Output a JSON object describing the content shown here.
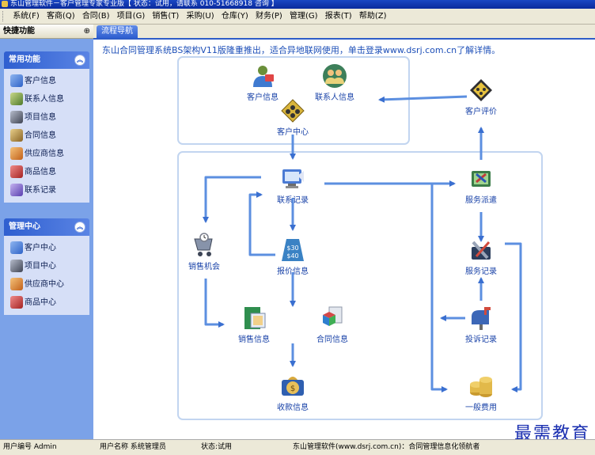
{
  "window": {
    "title": "东山管理软件－客户管理专家专业版【 状态：试用，请联系 010-51668918 咨询 】"
  },
  "menu": [
    {
      "label": "系统(F)"
    },
    {
      "label": "客商(Q)"
    },
    {
      "label": "合同(B)"
    },
    {
      "label": "项目(G)"
    },
    {
      "label": "销售(T)"
    },
    {
      "label": "采购(U)"
    },
    {
      "label": "仓库(Y)"
    },
    {
      "label": "财务(P)"
    },
    {
      "label": "管理(G)"
    },
    {
      "label": "报表(T)"
    },
    {
      "label": "帮助(Z)"
    }
  ],
  "sidebar": {
    "title": "快捷功能",
    "pin_glyph": "⊕",
    "panels": [
      {
        "title": "常用功能",
        "collapse_glyph": "︽",
        "items": [
          {
            "label": "客户信息",
            "icon": "customer-info-icon",
            "color": "#4a7fd6"
          },
          {
            "label": "联系人信息",
            "icon": "contact-info-icon",
            "color": "#6b8e3f"
          },
          {
            "label": "项目信息",
            "icon": "project-info-icon",
            "color": "#555b6a"
          },
          {
            "label": "合同信息",
            "icon": "contract-info-icon",
            "color": "#9c7a3a"
          },
          {
            "label": "供应商信息",
            "icon": "supplier-info-icon",
            "color": "#d9812b"
          },
          {
            "label": "商品信息",
            "icon": "product-info-icon",
            "color": "#c23a3a"
          },
          {
            "label": "联系记录",
            "icon": "contact-record-icon",
            "color": "#7a5fc8"
          }
        ]
      },
      {
        "title": "管理中心",
        "collapse_glyph": "︽",
        "items": [
          {
            "label": "客户中心",
            "icon": "customer-center-icon",
            "color": "#4a7fd6"
          },
          {
            "label": "项目中心",
            "icon": "project-center-icon",
            "color": "#555b6a"
          },
          {
            "label": "供应商中心",
            "icon": "supplier-center-icon",
            "color": "#d9812b"
          },
          {
            "label": "商品中心",
            "icon": "product-center-icon",
            "color": "#c23a3a"
          }
        ]
      }
    ]
  },
  "tabs": [
    {
      "label": "流程导航"
    }
  ],
  "flow": {
    "notice": "东山合同管理系统BS架构V11版隆重推出，适合异地联网使用，单击登录www.dsrj.com.cn了解详情。",
    "nodes": {
      "customer_info": {
        "label": "客户信息",
        "icon": "customer-info-icon"
      },
      "contact_info": {
        "label": "联系人信息",
        "icon": "contact-people-icon"
      },
      "customer_center": {
        "label": "客户中心",
        "icon": "customer-center-icon"
      },
      "customer_review": {
        "label": "客户评价",
        "icon": "customer-review-icon"
      },
      "contact_record": {
        "label": "联系记录",
        "icon": "contact-record-icon"
      },
      "service_dispatch": {
        "label": "服务派遣",
        "icon": "service-dispatch-icon"
      },
      "sales_opportunity": {
        "label": "销售机会",
        "icon": "shopping-cart-icon"
      },
      "quote_info": {
        "label": "报价信息",
        "icon": "price-tag-icon"
      },
      "service_record": {
        "label": "服务记录",
        "icon": "service-tools-icon"
      },
      "sales_info": {
        "label": "销售信息",
        "icon": "sales-info-icon"
      },
      "contract_info": {
        "label": "合同信息",
        "icon": "contract-blocks-icon"
      },
      "complaint_record": {
        "label": "投诉记录",
        "icon": "mailbox-icon"
      },
      "payment_info": {
        "label": "收款信息",
        "icon": "money-bag-icon"
      },
      "general_expense": {
        "label": "一般费用",
        "icon": "coins-icon"
      }
    }
  },
  "status": {
    "user_id": "用户编号  Admin",
    "user_name": "用户名称  系统管理员",
    "state": "状态:试用",
    "company": "东山管理软件(www.dsrj.com.cn)：合同管理信息化领航者"
  },
  "watermark": "最需教育"
}
